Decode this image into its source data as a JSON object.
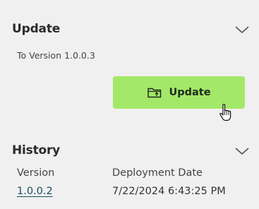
{
  "update_section": {
    "title": "Update",
    "target_version_text": "To Version 1.0.0.3",
    "button_label": "Update",
    "accent_color": "#a3e868"
  },
  "history_section": {
    "title": "History",
    "columns": [
      "Version",
      "Deployment Date"
    ],
    "rows": [
      {
        "version": "1.0.0.2",
        "deployment_date": "7/22/2024 6:43:25 PM"
      }
    ]
  },
  "icons": {
    "collapse": "chevron-down-icon",
    "button": "folder-upload-icon",
    "cursor": "hand-pointer-cursor"
  }
}
